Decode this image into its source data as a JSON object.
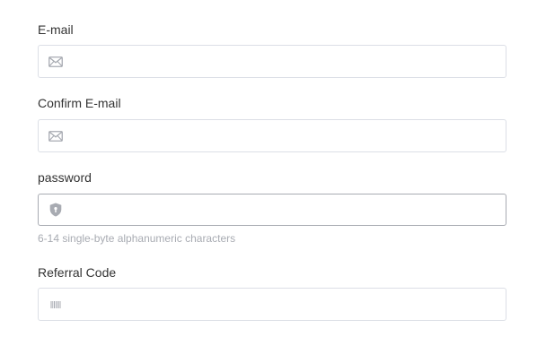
{
  "form": {
    "email": {
      "label": "E-mail",
      "value": "",
      "placeholder": "",
      "icon": "mail-icon"
    },
    "confirm_email": {
      "label": "Confirm E-mail",
      "value": "",
      "placeholder": "",
      "icon": "mail-icon"
    },
    "password": {
      "label": "password",
      "value": "",
      "placeholder": "",
      "icon": "shield-lock-icon",
      "hint": "6-14 single-byte alphanumeric characters"
    },
    "referral_code": {
      "label": "Referral Code",
      "value": "",
      "placeholder": "",
      "icon": "barcode-icon"
    }
  },
  "colors": {
    "border": "#dcdfe6",
    "border_focused": "#a8abb2",
    "label_text": "#333333",
    "hint_text": "#a8abb2",
    "icon": "#a8abb2"
  }
}
